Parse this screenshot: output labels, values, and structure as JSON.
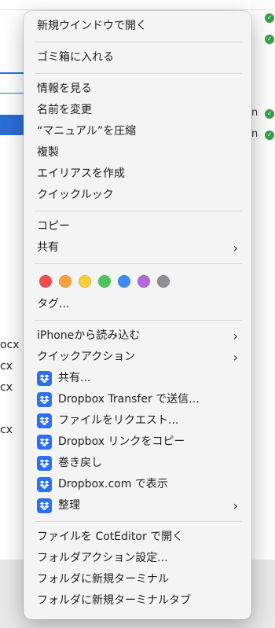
{
  "background": {
    "fragments": [
      "ocx",
      "cx",
      "cx",
      "cx"
    ],
    "right_letters": [
      "n",
      "n"
    ]
  },
  "menu": {
    "open_new_window": "新規ウインドウで開く",
    "move_to_trash": "ゴミ箱に入れる",
    "get_info": "情報を見る",
    "rename": "名前を変更",
    "compress": "“マニュアル”を圧縮",
    "duplicate": "複製",
    "make_alias": "エイリアスを作成",
    "quick_look": "クイックルック",
    "copy": "コピー",
    "share": "共有",
    "tag_colors": [
      "#f24d4d",
      "#f7a03c",
      "#f5cf3b",
      "#4ec45e",
      "#3b8ef0",
      "#b267db",
      "#8e8e93"
    ],
    "tags": "タグ...",
    "import_from_iphone": "iPhoneから読み込む",
    "quick_actions": "クイックアクション",
    "dropbox_share": "共有...",
    "dropbox_transfer": "Dropbox Transfer で送信...",
    "request_files": "ファイルをリクエスト...",
    "copy_dropbox_link": "Dropbox リンクをコピー",
    "rewind": "巻き戻し",
    "view_on_dropbox": "Dropbox.com で表示",
    "organize": "整理",
    "open_in_coteditor": "ファイルを CotEditor で開く",
    "folder_actions_setup": "フォルダアクション設定...",
    "new_terminal_at_folder": "フォルダに新規ターミナル",
    "new_terminal_tab_at_folder": "フォルダに新規ターミナルタブ"
  },
  "colors": {
    "accent": "#2a6ed6",
    "dropbox_blue": "#2a6ff5",
    "sync_green": "#2fa546"
  }
}
